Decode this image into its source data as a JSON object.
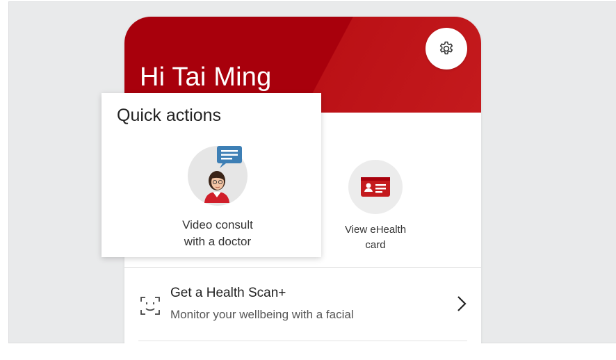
{
  "header": {
    "greeting": "Hi Tai Ming",
    "settings_icon": "gear-icon",
    "colors": {
      "primary_red": "#a8000c",
      "secondary_red": "#c41a1d"
    }
  },
  "quick_actions": {
    "title": "Quick actions",
    "items": [
      {
        "label": "Video consult\nwith a doctor",
        "icon": "doctor-chat-icon"
      }
    ]
  },
  "actions": [
    {
      "label": "View eHealth\ncard",
      "icon": "id-card-icon"
    }
  ],
  "health_scan": {
    "title": "Get a Health Scan+",
    "subtitle": "Monitor your wellbeing with a facial",
    "icon": "face-scan-icon",
    "chevron": "chevron-right-icon"
  }
}
